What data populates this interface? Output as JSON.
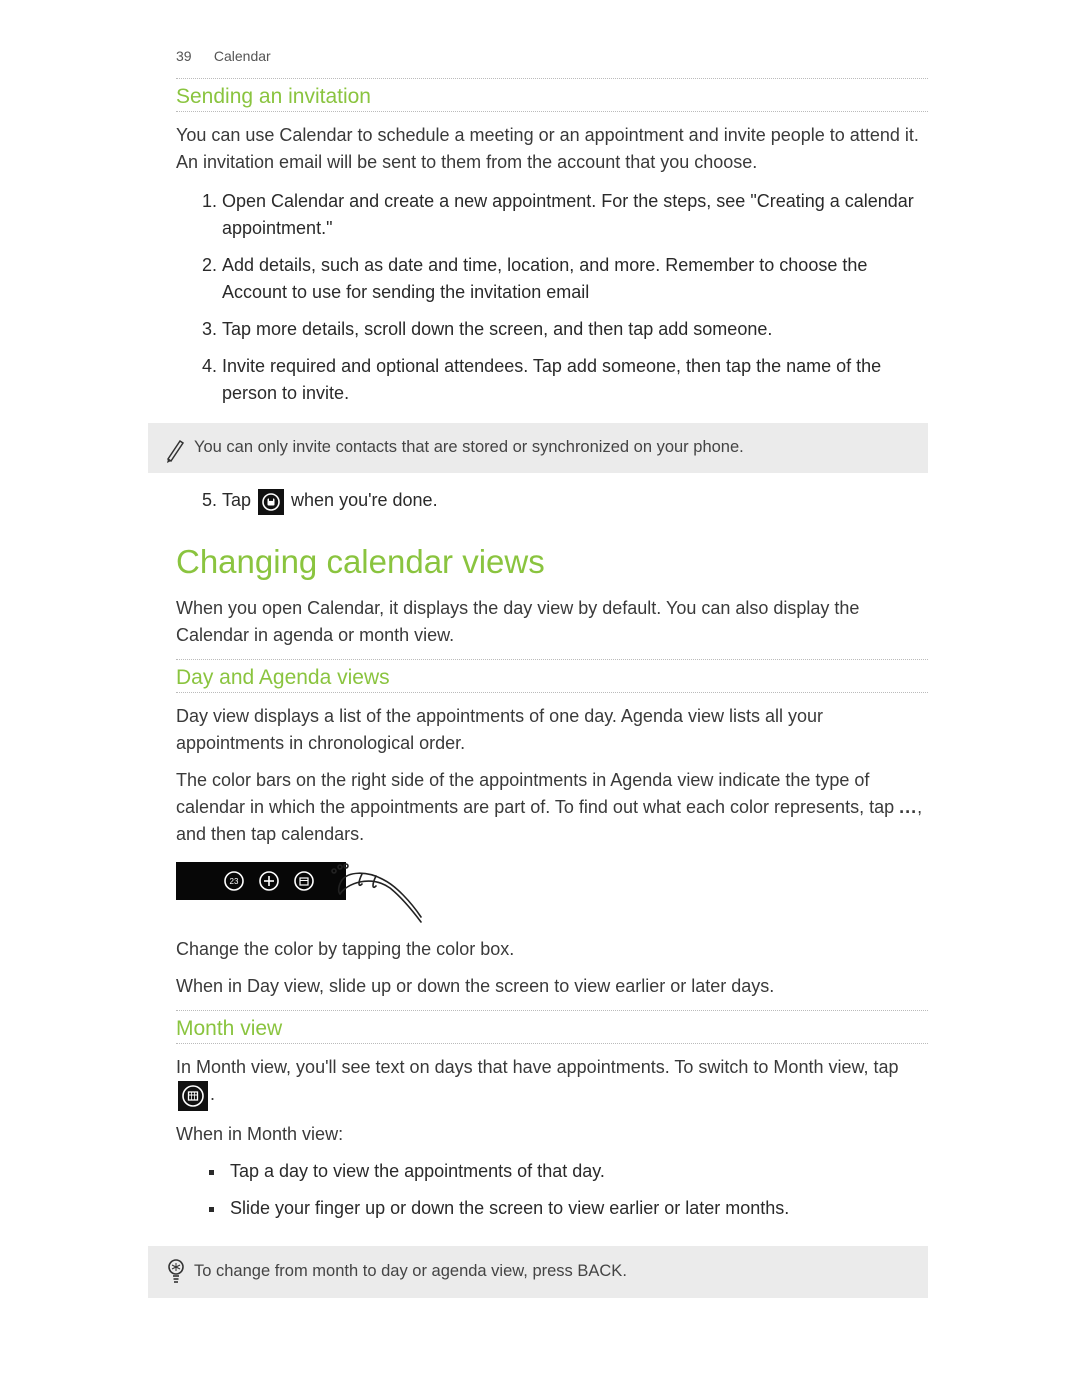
{
  "header": {
    "page_number": "39",
    "chapter": "Calendar"
  },
  "section1": {
    "title": "Sending an invitation",
    "intro": "You can use Calendar to schedule a meeting or an appointment and invite people to attend it. An invitation email will be sent to them from the account that you choose.",
    "steps": {
      "s1": "Open Calendar and create a new appointment. For the steps, see \"Creating a calendar appointment.\"",
      "s2a": "Add details, such as date and time, location, and more. Remember to choose the ",
      "s2b": "Account",
      "s2c": " to use for sending the invitation email",
      "s3a": "Tap ",
      "s3b": "more details",
      "s3c": ", scroll down the screen, and then tap ",
      "s3d": "add someone",
      "s3e": ".",
      "s4a": "Invite required and optional attendees. Tap ",
      "s4b": "add someone",
      "s4c": ", then tap the name of the person to invite.",
      "s5a": "Tap ",
      "s5b": " when you're done."
    },
    "note": "You can only invite contacts that are stored or synchronized on your phone."
  },
  "section2": {
    "title": "Changing calendar views",
    "intro": "When you open Calendar, it displays the day view by default. You can also display the Calendar in agenda or month view."
  },
  "section3": {
    "title": "Day and Agenda views",
    "p1": "Day view displays a list of the appointments of one day. Agenda view lists all your appointments in chronological order.",
    "p2a": "The color bars on the right side of the appointments in Agenda view indicate the type of calendar in which the appointments are part of. To find out what each color represents, tap ",
    "p2b": "...",
    "p2c": ", and then tap ",
    "p2d": "calendars",
    "p2e": ".",
    "p3": "Change the color by tapping the color box.",
    "p4": "When in Day view, slide up or down the screen to view earlier or later days."
  },
  "section4": {
    "title": "Month view",
    "p1a": "In Month view, you'll see text on days that have appointments. To switch to Month view, tap ",
    "p1b": ".",
    "p2": "When in Month view:",
    "bullets": {
      "b1": "Tap a day to view the appointments of that day.",
      "b2": "Slide your finger up or down the screen to view earlier or later months."
    },
    "tip": "To change from month to day or agenda view, press BACK."
  }
}
